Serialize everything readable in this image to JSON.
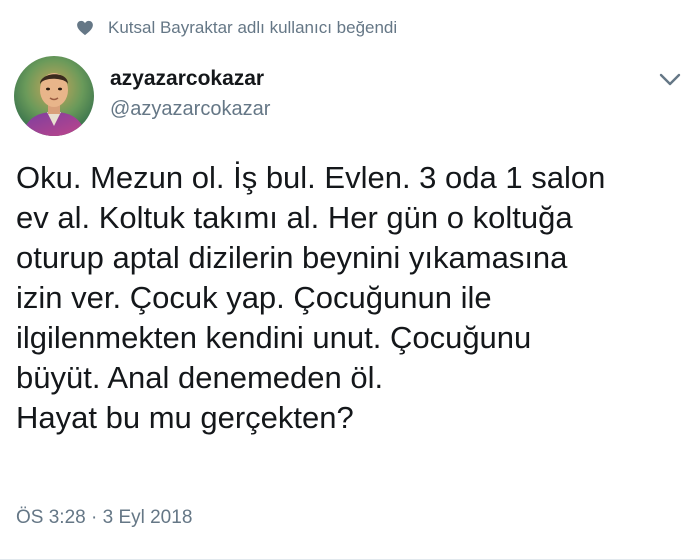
{
  "social_context": {
    "icon": "heart-icon",
    "text": "Kutsal Bayraktar adlı kullanıcı beğendi"
  },
  "author": {
    "display_name": "azyazarcokazar",
    "handle": "@azyazarcokazar"
  },
  "tweet": {
    "text": "Oku. Mezun ol. İş bul. Evlen. 3 oda 1 salon\nev al. Koltuk takımı al. Her gün o koltuğa\noturup aptal dizilerin beynini yıkamasına\nizin ver. Çocuk yap. Çocuğunun ile\nilgilenmekten kendini unut. Çocuğunu\nbüyüt. Anal denemeden öl.\nHayat bu mu gerçekten?",
    "timestamp": "ÖS 3:28 · 3 Eyl 2018"
  },
  "colors": {
    "text_primary": "#14171a",
    "text_secondary": "#657786",
    "divider": "#e1e8ed"
  }
}
